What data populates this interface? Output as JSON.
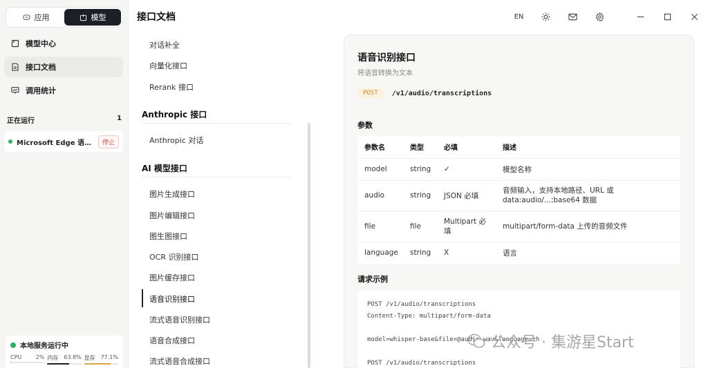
{
  "sidebar": {
    "modes": [
      {
        "label": "应用",
        "active": false
      },
      {
        "label": "模型",
        "active": true
      }
    ],
    "nav": [
      {
        "label": "模型中心",
        "icon": "box-icon"
      },
      {
        "label": "接口文档",
        "icon": "document-icon",
        "active": true
      },
      {
        "label": "调用统计",
        "icon": "chart-icon"
      }
    ],
    "running": {
      "label": "正在运行",
      "count": "1",
      "item_name": "Microsoft Edge 语音...",
      "stop_label": "停止"
    },
    "service": {
      "title": "本地服务运行中",
      "stats": [
        {
          "label": "CPU",
          "value": "2%",
          "percent": 2,
          "color": "#7aa7d9"
        },
        {
          "label": "内存",
          "value": "63.8%",
          "percent": 63.8,
          "color": "#1c1f26"
        },
        {
          "label": "显存",
          "value": "77.1%",
          "percent": 77.1,
          "color": "#e0a340"
        }
      ]
    }
  },
  "header": {
    "title": "接口文档",
    "lang": "EN"
  },
  "apilist": {
    "items_top": [
      "对话补全",
      "向量化接口",
      "Rerank 接口"
    ],
    "group_anthropic": "Anthropic 接口",
    "items_anthropic": [
      "Anthropic 对话"
    ],
    "group_ai": "AI 模型接口",
    "items_ai": [
      "图片生成接口",
      "图片编辑接口",
      "图生图接口",
      "OCR 识别接口",
      "图片缓存接口",
      "语音识别接口",
      "流式语音识别接口",
      "语音合成接口",
      "流式语音合成接口"
    ],
    "active_index": 5
  },
  "doc": {
    "title": "语音识别接口",
    "subtitle": "将语音转换为文本",
    "method": "POST",
    "endpoint": "/v1/audio/transcriptions",
    "params_label": "参数",
    "columns": [
      "参数名",
      "类型",
      "必填",
      "描述"
    ],
    "rows": [
      [
        "model",
        "string",
        "✓",
        "模型名称"
      ],
      [
        "audio",
        "string",
        "JSON 必填",
        "音频输入，支持本地路径、URL 或 data:audio/...;base64 数据"
      ],
      [
        "file",
        "file",
        "Multipart 必填",
        "multipart/form-data 上传的音频文件"
      ],
      [
        "language",
        "string",
        "X",
        "语言"
      ]
    ],
    "example_label": "请求示例",
    "code_lines": [
      "POST /v1/audio/transcriptions",
      "Content-Type: multipart/form-data",
      "",
      "model=whisper-base&file=@audio.wav&language=zh",
      "",
      "POST /v1/audio/transcriptions"
    ]
  },
  "watermark": "公众号 · 集游星Start"
}
